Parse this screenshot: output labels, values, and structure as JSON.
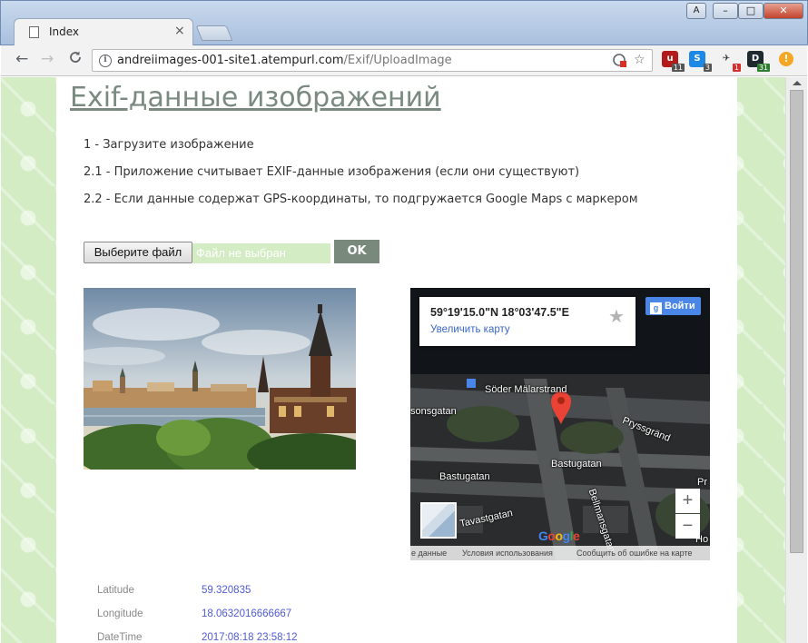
{
  "browser": {
    "tab_title": "Index",
    "tab_close": "×",
    "url_host": "andreiimages-001-site1.atempurl.com",
    "url_path": "/Exif/UploadImage",
    "window_user_label": "A",
    "window_minimize": "–",
    "window_maximize": "□",
    "window_close": "✕",
    "nav_back": "←",
    "nav_forward": "→",
    "nav_reload": "C",
    "extensions": [
      {
        "icon": "ublock-icon",
        "label": "u",
        "badge": "11",
        "color": "#b31b1b"
      },
      {
        "icon": "skype-icon",
        "label": "S",
        "badge": "3",
        "color": "#1e88e5"
      },
      {
        "icon": "airplane-icon",
        "label": "✈",
        "badge": "1",
        "color": "#333333"
      },
      {
        "icon": "dashlane-icon",
        "label": "D",
        "badge": "31",
        "color": "#1f2a2e"
      }
    ],
    "menu_label": "!"
  },
  "page": {
    "title": "Exif-данные изображений",
    "steps": [
      "1 - Загрузите изображение",
      "2.1 - Приложение считывает EXIF-данные изображения (если они существуют)",
      "2.2 - Если данные содержат GPS-координаты, то подгружается Google Maps с маркером"
    ],
    "file_button": "Выберите файл",
    "file_placeholder": "Файл не выбран",
    "ok_button": "OK",
    "accent_color": "#798a7c",
    "background_color": "#d3ecc4"
  },
  "map": {
    "coords": "59°19'15.0\"N 18°03'47.5\"E",
    "enlarge_link": "Увеличить карту",
    "signin": "Войти",
    "signin_icon": "g",
    "streets": {
      "soder": "Söder Mälarstrand",
      "sonsgatan": "sonsgatan",
      "pryssgrand": "Pryssgränd",
      "bastugatan_left": "Bastugatan",
      "bastugatan_right": "Bastugatan",
      "bellmansgatan": "Bellmansgatan",
      "tavastgatan": "Tavastgatan",
      "pr": "Pr",
      "ho": "Ho"
    },
    "zoom_in": "+",
    "zoom_out": "−",
    "logo_letters": [
      "G",
      "o",
      "o",
      "g",
      "l",
      "e"
    ],
    "footer_data": "е данные",
    "footer_terms": "Условия использования",
    "footer_report": "Сообщить об ошибке на карте"
  },
  "metadata": [
    {
      "label": "Latitude",
      "value": "59.320835"
    },
    {
      "label": "Longitude",
      "value": "18.0632016666667"
    },
    {
      "label": "DateTime",
      "value": "2017:08:18 23:58:12"
    }
  ]
}
